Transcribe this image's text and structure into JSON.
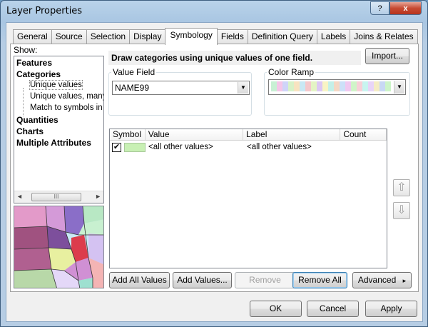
{
  "window": {
    "title": "Layer Properties",
    "help_label": "?",
    "close_label": "x"
  },
  "tabs": [
    {
      "label": "General"
    },
    {
      "label": "Source"
    },
    {
      "label": "Selection"
    },
    {
      "label": "Display"
    },
    {
      "label": "Symbology",
      "active": true
    },
    {
      "label": "Fields"
    },
    {
      "label": "Definition Query"
    },
    {
      "label": "Labels"
    },
    {
      "label": "Joins & Relates"
    }
  ],
  "show": {
    "label": "Show:",
    "items": [
      {
        "label": "Features",
        "level": 0
      },
      {
        "label": "Categories",
        "level": 0
      },
      {
        "label": "Unique values",
        "level": 1,
        "selected": true
      },
      {
        "label": "Unique values, many f",
        "level": 1
      },
      {
        "label": "Match to symbols in a",
        "level": 1
      },
      {
        "label": "Quantities",
        "level": 0
      },
      {
        "label": "Charts",
        "level": 0
      },
      {
        "label": "Multiple Attributes",
        "level": 0
      }
    ],
    "scroll_left": "◄",
    "scroll_right": "►",
    "scroll_grip": "III"
  },
  "description": "Draw categories using unique values of one field.",
  "import_label": "Import...",
  "value_field": {
    "label": "Value Field",
    "value": "NAME99"
  },
  "color_ramp": {
    "label": "Color Ramp",
    "colors": [
      "#c8f0d4",
      "#f5c6e8",
      "#cfd4f8",
      "#d8f2c8",
      "#f8e3c0",
      "#c8e8f4",
      "#f4c8cc",
      "#e4f4c4",
      "#dcc8f4",
      "#f8f4c4",
      "#c4f0e8",
      "#f4d8c4",
      "#cce0f8",
      "#f0c8f0",
      "#d0f4c8",
      "#f8d0d8",
      "#c8f4f0",
      "#e8d4f8",
      "#f4ecc4",
      "#c8d8f4",
      "#ccf4c8"
    ]
  },
  "table": {
    "columns": [
      "Symbol",
      "Value",
      "Label",
      "Count"
    ],
    "rows": [
      {
        "checked": true,
        "check_mark": "✔",
        "symbol_color": "#c8f0b4",
        "value": "<all other values>",
        "label": "<all other values>",
        "count": ""
      }
    ]
  },
  "move_up_icon": "⇧",
  "move_down_icon": "⇩",
  "buttons": {
    "add_all_values": "Add All Values",
    "add_values": "Add Values...",
    "remove": "Remove",
    "remove_all": "Remove All",
    "advanced": "Advanced",
    "advanced_arrow": "▸",
    "ok": "OK",
    "cancel": "Cancel",
    "apply": "Apply"
  }
}
